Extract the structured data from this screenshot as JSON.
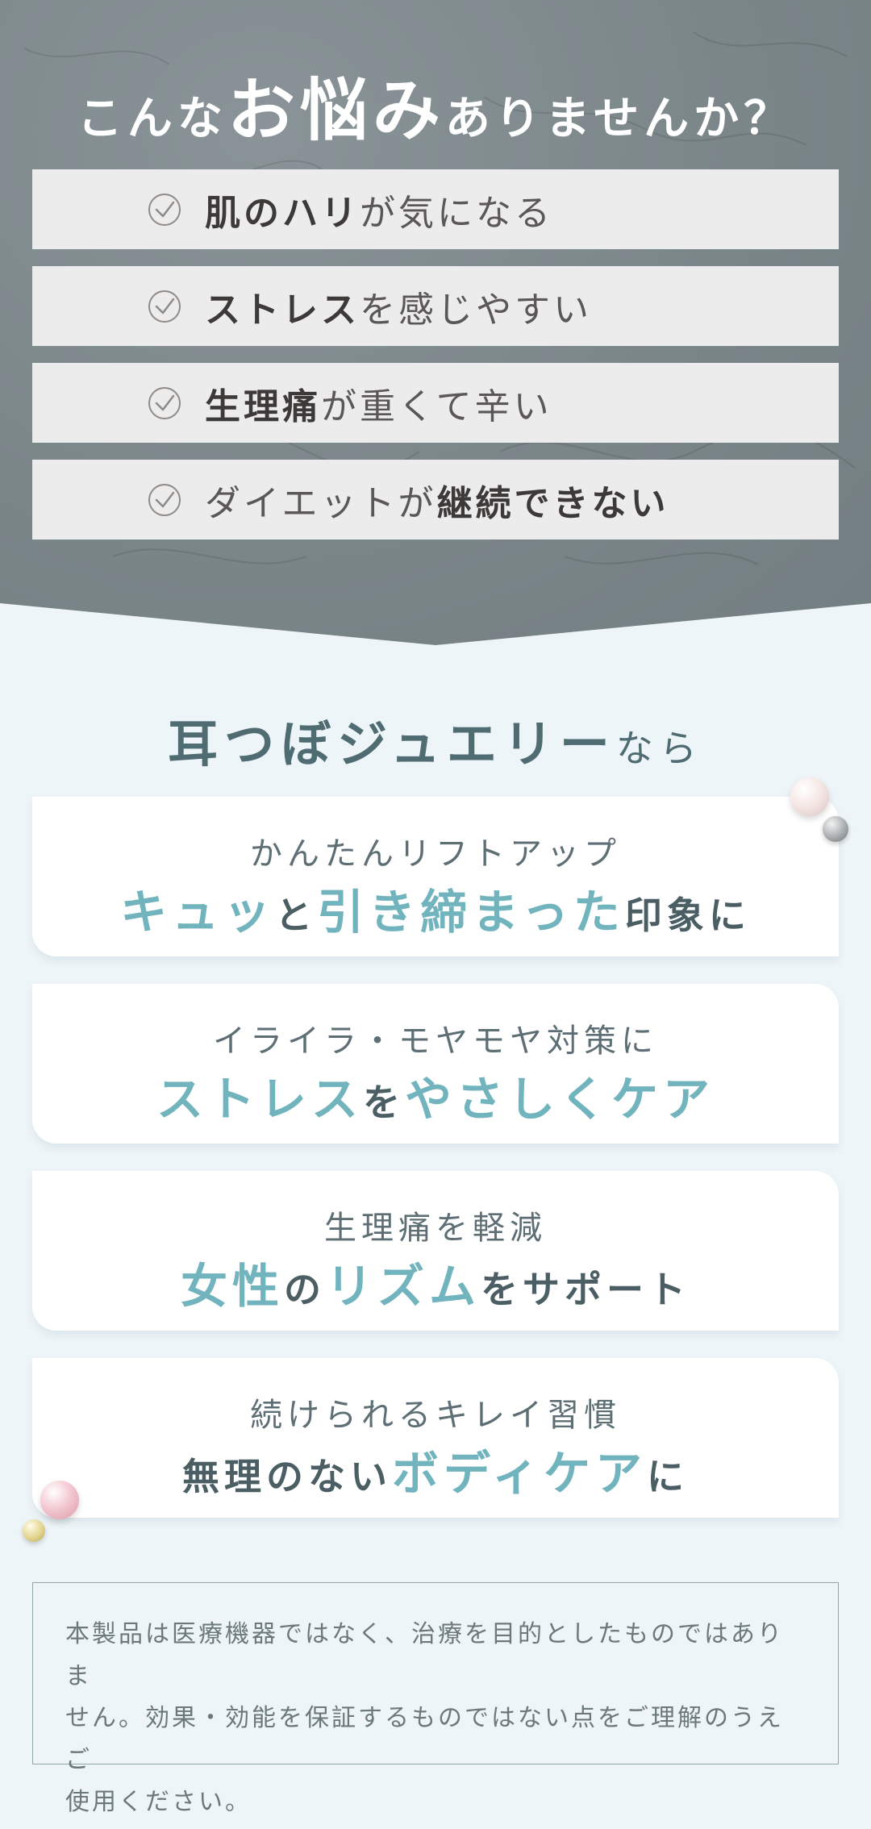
{
  "problems": {
    "heading": {
      "pre": "こんな",
      "big": "お悩み",
      "post": "ありませんか？"
    },
    "items": [
      {
        "bold": "肌のハリ",
        "normal": "が気になる",
        "order": "bold-first"
      },
      {
        "bold": "ストレス",
        "normal": "を感じやすい",
        "order": "bold-first"
      },
      {
        "bold": "生理痛",
        "normal": "が重くて辛い",
        "order": "bold-first"
      },
      {
        "bold": "継続できない",
        "normal": "ダイエットが",
        "order": "normal-first"
      }
    ]
  },
  "solutions": {
    "heading": {
      "product": "耳つぼジュエリー",
      "suffix": "なら"
    },
    "cards": [
      {
        "sub": "かんたんリフトアップ",
        "parts": [
          {
            "t": "キュッ",
            "hl": true
          },
          {
            "t": "と",
            "hl": false
          },
          {
            "t": "引き締まった",
            "hl": true
          },
          {
            "t": "印象に",
            "hl": false
          }
        ]
      },
      {
        "sub": "イライラ・モヤモヤ対策に",
        "parts": [
          {
            "t": "ストレス",
            "hl": true
          },
          {
            "t": "を",
            "hl": false
          },
          {
            "t": "やさしくケア",
            "hl": true
          }
        ]
      },
      {
        "sub": "生理痛を軽減",
        "parts": [
          {
            "t": "女性",
            "hl": true
          },
          {
            "t": "の",
            "hl": false
          },
          {
            "t": "リズム",
            "hl": true
          },
          {
            "t": "をサポート",
            "hl": false
          }
        ]
      },
      {
        "sub": "続けられるキレイ習慣",
        "parts": [
          {
            "t": "無理のない",
            "hl": false
          },
          {
            "t": "ボディケア",
            "hl": true
          },
          {
            "t": "に",
            "hl": false
          }
        ]
      }
    ]
  },
  "disclaimer": {
    "line1": "本製品は医療機器ではなく、治療を目的としたものではありま",
    "line2": "せん。効果・効能を保証するものではない点をご理解のうえご",
    "line3": "使用ください。"
  },
  "colors": {
    "top_bg": "#7b8689",
    "accent": "#72b4bd",
    "dark_text": "#4a5e64",
    "page_bg": "#eef5f8"
  },
  "icons": [
    "check-circle-icon",
    "pearl-decoration"
  ]
}
